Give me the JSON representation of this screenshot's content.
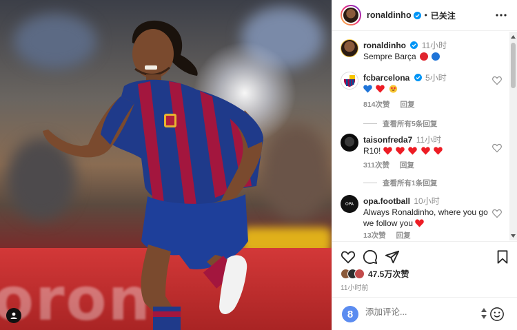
{
  "post": {
    "author": "ronaldinho",
    "follow_status": "已关注",
    "caption_author": "ronaldinho",
    "caption_time": "11小时",
    "caption_text": "Sempre Barça",
    "likes": "47.5万次赞",
    "posted_ago": "11小时前"
  },
  "comments": [
    {
      "user": "fcbarcelona",
      "verified": true,
      "time": "5小时",
      "likes": "814次赞",
      "reply_label": "回复",
      "view_replies": "查看所有5条回复"
    },
    {
      "user": "taisonfreda7",
      "verified": false,
      "time": "11小时",
      "text": "R10!",
      "likes": "311次赞",
      "reply_label": "回复",
      "view_replies": "查看所有1条回复"
    },
    {
      "user": "opa.football",
      "verified": false,
      "time": "10小时",
      "text": "Always Ronaldinho, where you go we follow you",
      "likes": "13次赞",
      "reply_label": "回复"
    }
  ],
  "comment_bar": {
    "placeholder": "添加评论..."
  },
  "icons": {
    "more": "more-horizontal-icon",
    "like": "heart-outline-icon",
    "comment": "speech-bubble-icon",
    "share": "paper-plane-icon",
    "save": "bookmark-icon",
    "verified": "verified-badge-icon",
    "emoji": "smiley-icon"
  },
  "colors": {
    "verified_blue": "#0095f6",
    "barca_red": "#a50044",
    "barca_blue": "#004d98",
    "heart_red": "#ed1c24",
    "text_secondary": "#8e8e8e"
  }
}
